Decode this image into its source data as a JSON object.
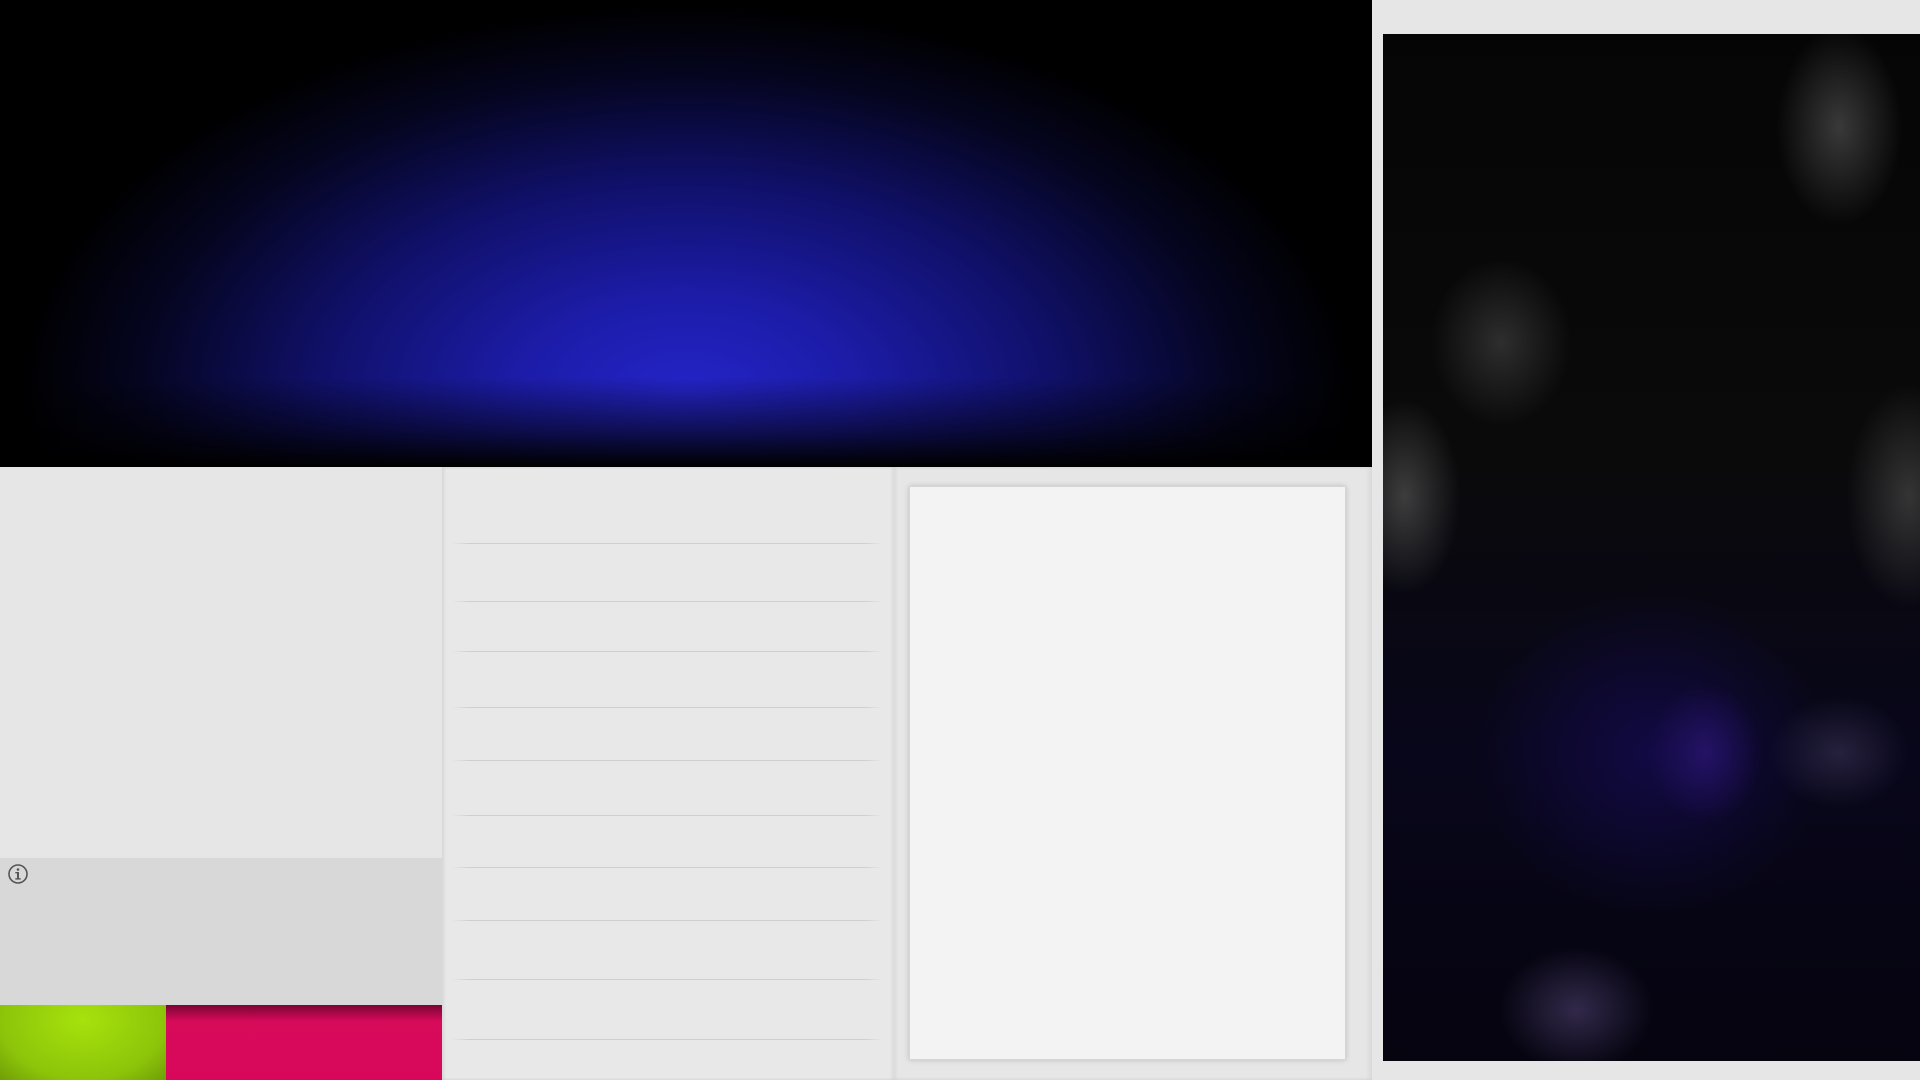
{
  "hero": {
    "colors": {
      "center": "#2424c8",
      "edge": "#000000"
    }
  },
  "media_panel": {
    "colors": {
      "base": "#050505",
      "tint": "#120a46"
    }
  },
  "info_panel": {
    "icon": "info-circle-icon"
  },
  "action_buttons": {
    "green": {
      "label": "",
      "color": "#8cc40a"
    },
    "pink": {
      "label": "",
      "color": "#d8075a"
    }
  },
  "list": {
    "items": [
      "",
      "",
      "",
      "",
      "",
      "",
      "",
      "",
      "",
      "",
      ""
    ]
  },
  "detail_card": {
    "content": ""
  }
}
